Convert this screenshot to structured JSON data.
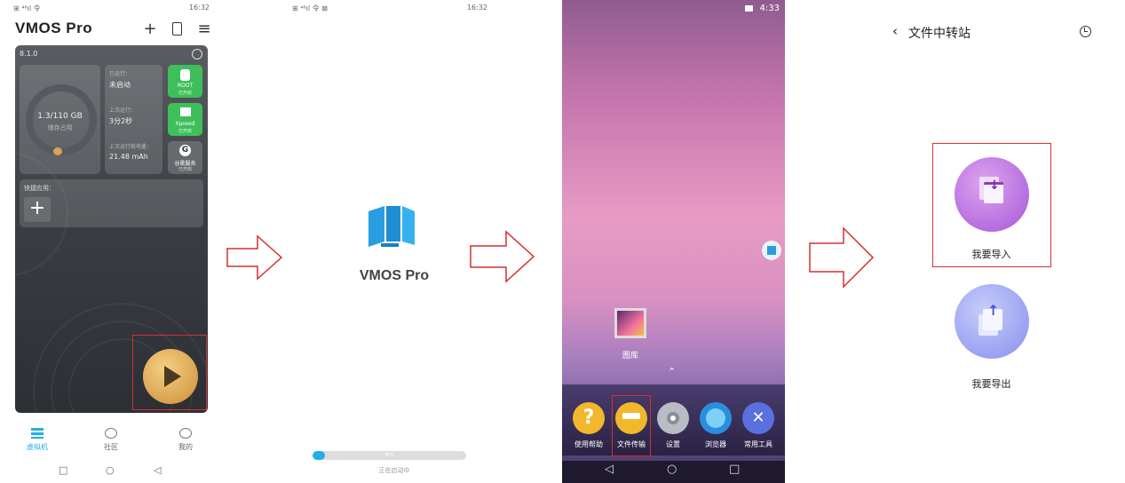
{
  "screen1": {
    "status": "⊞ ⁴⁶ıl 令",
    "time": "16:32",
    "app_title": "VMOS  Pro",
    "vm_version": "8.1.0",
    "storage_value": "1.3/110 GB",
    "storage_label": "储存占用",
    "storage_fraction": 0.012,
    "info_rows": [
      {
        "label": "已运行：",
        "value": "未启动"
      },
      {
        "label": "上次运行：",
        "value": "3分2秒"
      },
      {
        "label": "上次运行耗电量：",
        "value": "21.48 mAh"
      }
    ],
    "feature_buttons": [
      {
        "title": "ROOT",
        "sub": "已开启"
      },
      {
        "title": "Xposed",
        "sub": "已开启"
      },
      {
        "title": "谷歌服务",
        "sub": "已开启"
      }
    ],
    "quick_label": "快捷应用：",
    "bottom_nav": [
      {
        "label": "虚拟机",
        "active": true
      },
      {
        "label": "社区",
        "active": false
      },
      {
        "label": "我的",
        "active": false
      }
    ],
    "accent": "#23aee6",
    "play_color": "#d9a24e"
  },
  "screen2": {
    "status": "⊞ ⁴⁶ıl 令 ⊠",
    "time": "16:32",
    "app_name": "VMOS Pro",
    "progress_text": "8%",
    "progress_value": 0.08,
    "loading_text": "正在启动中"
  },
  "screen3": {
    "time": "4:33",
    "gallery_label": "图库",
    "dock": [
      {
        "label": "使用帮助",
        "glyph": "?"
      },
      {
        "label": "文件传输",
        "glyph": ""
      },
      {
        "label": "设置",
        "glyph": ""
      },
      {
        "label": "浏览器",
        "glyph": ""
      },
      {
        "label": "常用工具",
        "glyph": ""
      }
    ]
  },
  "screen4": {
    "title": "文件中转站",
    "import_label": "我要导入",
    "export_label": "我要导出"
  },
  "colors": {
    "highlight": "#d43030",
    "arrow_stroke": "#d43030"
  }
}
